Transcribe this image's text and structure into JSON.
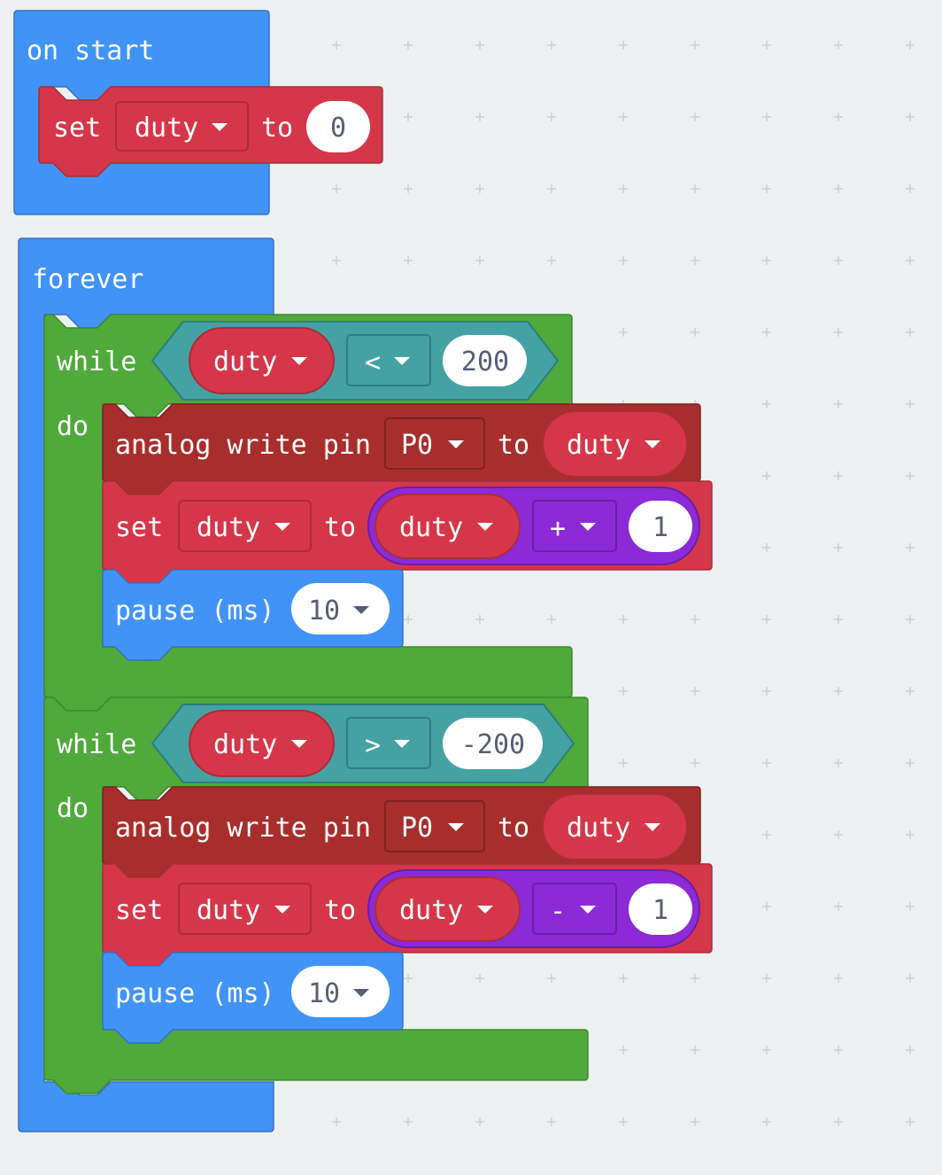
{
  "workspace": {
    "background": "#ecf0f1",
    "grid_mark_color": "#c8d1d8"
  },
  "colors": {
    "events": "#4293f8",
    "variables": "#d63649",
    "variables_dark": "#a72f30",
    "pins": "#a82e2e",
    "loops": "#4fa93b",
    "logic": "#45a2a4",
    "math": "#8c2ad7",
    "basic": "#4293f8"
  },
  "on_start": {
    "label": "on start",
    "set_block": {
      "set_label": "set",
      "variable": "duty",
      "to_label": "to",
      "value": "0"
    }
  },
  "forever": {
    "label": "forever",
    "while1": {
      "while_label": "while",
      "do_label": "do",
      "condition": {
        "left": "duty",
        "operator": "<",
        "right": "200"
      },
      "analog_write": {
        "label": "analog write pin",
        "pin": "P0",
        "to_label": "to",
        "value": "duty"
      },
      "set_block": {
        "set_label": "set",
        "variable": "duty",
        "to_label": "to",
        "left": "duty",
        "operator": "+",
        "right": "1"
      },
      "pause": {
        "label": "pause (ms)",
        "value": "10"
      }
    },
    "while2": {
      "while_label": "while",
      "do_label": "do",
      "condition": {
        "left": "duty",
        "operator": ">",
        "right": "-200"
      },
      "analog_write": {
        "label": "analog write pin",
        "pin": "P0",
        "to_label": "to",
        "value": "duty"
      },
      "set_block": {
        "set_label": "set",
        "variable": "duty",
        "to_label": "to",
        "left": "duty",
        "operator": "-",
        "right": "1"
      },
      "pause": {
        "label": "pause (ms)",
        "value": "10"
      }
    }
  }
}
